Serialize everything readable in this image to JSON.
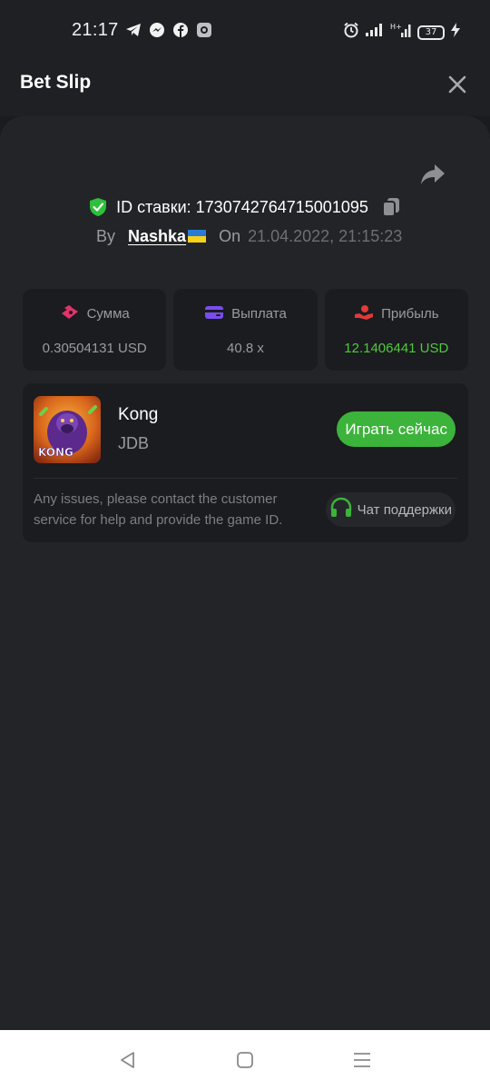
{
  "status_bar": {
    "time": "21:17",
    "app_icons": [
      "telegram-icon",
      "messenger-icon",
      "facebook-icon",
      "app-icon"
    ],
    "right_icons": [
      "alarm-icon",
      "signal-icon",
      "network-icon",
      "battery-icon",
      "charging-icon"
    ],
    "battery_level": "37"
  },
  "header": {
    "title": "Bet Slip",
    "close_icon": "close-icon"
  },
  "bet": {
    "id_label": "ID ставки: 1730742764715001095",
    "by_label": "By",
    "user": "Nashka",
    "on_label": "On",
    "date": "21.04.2022, 21:15:23"
  },
  "stats": [
    {
      "label": "Сумма",
      "value": "0.30504131 USD",
      "icon": "stake-icon",
      "icon_color": "#e2336b"
    },
    {
      "label": "Выплата",
      "value": "40.8 x",
      "icon": "card-icon",
      "icon_color": "#7a4cf0"
    },
    {
      "label": "Прибыль",
      "value": "12.1406441 USD",
      "icon": "profit-icon",
      "icon_color": "#e03a3a",
      "value_color": "#4ec93a"
    }
  ],
  "game": {
    "name": "Kong",
    "provider": "JDB",
    "thumb_text": "KONG",
    "play_label": "Играть сейчас",
    "issue_text": "Any issues, please contact the customer service for help and provide the game ID.",
    "support_label": "Чат поддержки"
  },
  "colors": {
    "accent_green": "#3cb33a",
    "shield_green": "#2fbf3a"
  }
}
